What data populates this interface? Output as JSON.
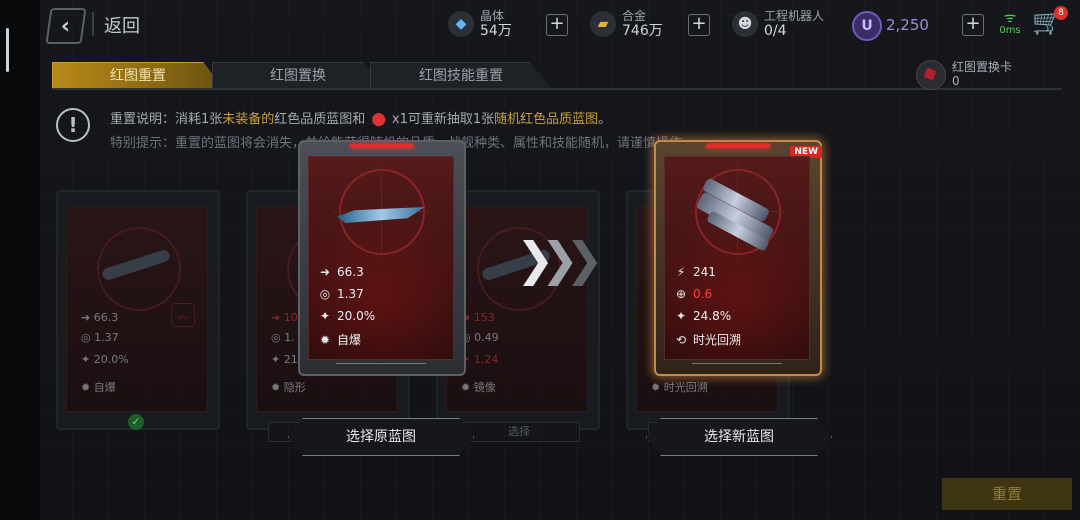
{
  "header": {
    "back_label": "返回",
    "resources": [
      {
        "name": "晶体",
        "value": "54万",
        "icon": "crystal-icon"
      },
      {
        "name": "合金",
        "value": "746万",
        "icon": "alloy-icon"
      },
      {
        "name": "工程机器人",
        "value": "0/4",
        "icon": "robot-icon"
      }
    ],
    "u_icon": "U",
    "u_value": "2,250",
    "ping": "0ms",
    "cart_badge": "8"
  },
  "tabs": [
    {
      "label": "红图重置",
      "active": true
    },
    {
      "label": "红图置换",
      "active": false
    },
    {
      "label": "红图技能重置",
      "active": false
    }
  ],
  "item_card": {
    "name": "红图置换卡",
    "count": "0"
  },
  "notice": {
    "line1_a": "重置说明：消耗1张",
    "line1_hl1": "未装备的",
    "line1_b": "红色品质蓝图和",
    "line1_c": "x1可重新抽取1张",
    "line1_hl2": "随机红色品质蓝图",
    "line1_d": "。",
    "line2": "特别提示：重置的蓝图将会消失，并给能获得随机的品质，战舰种类、属性和技能随机，请谨慎操作。"
  },
  "bg_cards": [
    {
      "stats": [
        "66.3",
        "1.37",
        "20.0%",
        "自爆"
      ],
      "footer": ""
    },
    {
      "stats": [
        "10",
        "1.",
        "21",
        "隐形"
      ],
      "footer": "选择"
    },
    {
      "stats": [
        "153",
        "0.49",
        "1.24",
        "镜像"
      ],
      "footer": "选择"
    },
    {
      "stats": [
        "",
        "",
        "",
        "时光回溯"
      ],
      "footer": "选择"
    }
  ],
  "original_card": {
    "speed": "66.3",
    "accuracy": "1.37",
    "crit": "20.0%",
    "skill": "自爆"
  },
  "new_card": {
    "tag": "NEW",
    "attack": "241",
    "aim": "0.6",
    "crit": "24.8%",
    "skill": "时光回溯"
  },
  "buttons": {
    "select_original": "选择原蓝图",
    "select_new": "选择新蓝图",
    "reset": "重置"
  },
  "colors": {
    "accent_gold": "#c6a036",
    "new_glow": "#e29646",
    "stat_red": "#ff3f3f"
  }
}
